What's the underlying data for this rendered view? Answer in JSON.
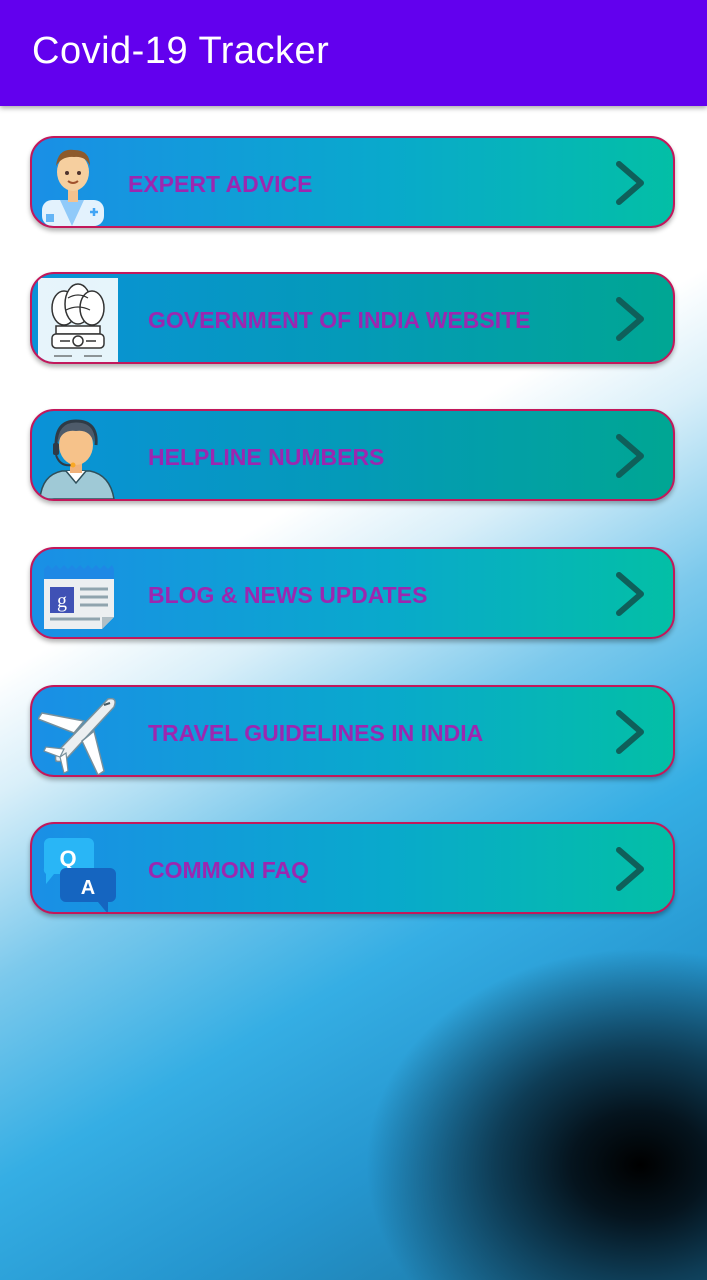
{
  "app": {
    "title": "Covid-19 Tracker"
  },
  "menu": [
    {
      "label": "EXPERT ADVICE",
      "icon": "doctor-icon"
    },
    {
      "label": "GOVERNMENT OF INDIA WEBSITE",
      "icon": "national-emblem-icon"
    },
    {
      "label": "HELPLINE NUMBERS",
      "icon": "headset-support-icon"
    },
    {
      "label": "BLOG & NEWS UPDATES",
      "icon": "news-icon"
    },
    {
      "label": "TRAVEL GUIDELINES IN INDIA",
      "icon": "airplane-icon"
    },
    {
      "label": "COMMON FAQ",
      "icon": "qa-icon"
    }
  ],
  "colors": {
    "appbar": "#6200ee",
    "label": "#9c27b0",
    "card_border": "#c2185b",
    "chevron": "#0f5f5a"
  }
}
